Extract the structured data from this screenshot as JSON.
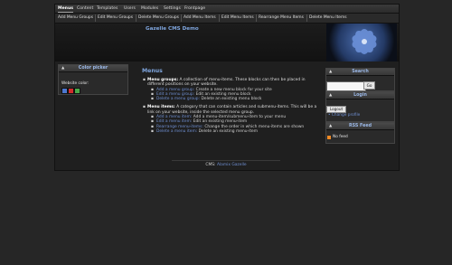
{
  "nav_main": [
    "Menus",
    "Content",
    "Templates",
    "Users",
    "Modules",
    "Settings",
    "Frontpage"
  ],
  "nav_sub": [
    "Add Menu Groups",
    "Edit Menu Groups",
    "Delete Menu Groups",
    "Add Menu Items",
    "Edit Menu Items",
    "Rearrange Menu Items",
    "Delete Menu Items"
  ],
  "banner": {
    "title": "Gazelle CMS Demo"
  },
  "left_box": {
    "title": "Color picker",
    "label": "Website color:",
    "swatches": [
      "#4d77cf",
      "#d32d2d",
      "#4aa74a"
    ]
  },
  "content": {
    "heading": "Menus",
    "groups_intro": "Menu groups:",
    "groups_text": "A collection of menu-items. These blocks can then be placed in different positions on your website.",
    "group_links": [
      {
        "link": "Add a menu group:",
        "text": "Create a new menu block for your site"
      },
      {
        "link": "Edit a menu group:",
        "text": "Edit an existing menu block"
      },
      {
        "link": "Delete a menu group:",
        "text": "Delete an existing menu block"
      }
    ],
    "items_intro": "Menu items:",
    "items_text": "A category that can contain articles and submenu-items. This will be a link on your website, inside the selected menu group.",
    "item_links": [
      {
        "link": "Add a menu item:",
        "text": "Add a menu-item/submenu-item to your menu"
      },
      {
        "link": "Edit a menu item:",
        "text": "Edit an existing menu-item"
      },
      {
        "link": "Rearrange menu-items:",
        "text": "Change the order in which menu-items are shown"
      },
      {
        "link": "Delete a menu item:",
        "text": "Delete an existing menu-item"
      }
    ]
  },
  "search_box": {
    "title": "Search",
    "button": "Go",
    "placeholder": ""
  },
  "login_box": {
    "title": "Login",
    "button": "Logout",
    "change": "Change profile"
  },
  "rss_box": {
    "title": "RSS Feed",
    "no_feed": "No feed"
  },
  "footer": {
    "prefix": "CMS:",
    "link": "Alamix Gazelle"
  }
}
